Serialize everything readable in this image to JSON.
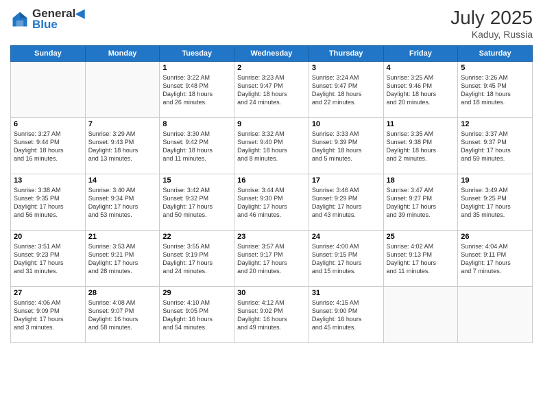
{
  "header": {
    "logo_line1": "General",
    "logo_line2": "Blue",
    "month_year": "July 2025",
    "location": "Kaduy, Russia"
  },
  "weekdays": [
    "Sunday",
    "Monday",
    "Tuesday",
    "Wednesday",
    "Thursday",
    "Friday",
    "Saturday"
  ],
  "weeks": [
    [
      {
        "day": "",
        "info": ""
      },
      {
        "day": "",
        "info": ""
      },
      {
        "day": "1",
        "info": "Sunrise: 3:22 AM\nSunset: 9:48 PM\nDaylight: 18 hours\nand 26 minutes."
      },
      {
        "day": "2",
        "info": "Sunrise: 3:23 AM\nSunset: 9:47 PM\nDaylight: 18 hours\nand 24 minutes."
      },
      {
        "day": "3",
        "info": "Sunrise: 3:24 AM\nSunset: 9:47 PM\nDaylight: 18 hours\nand 22 minutes."
      },
      {
        "day": "4",
        "info": "Sunrise: 3:25 AM\nSunset: 9:46 PM\nDaylight: 18 hours\nand 20 minutes."
      },
      {
        "day": "5",
        "info": "Sunrise: 3:26 AM\nSunset: 9:45 PM\nDaylight: 18 hours\nand 18 minutes."
      }
    ],
    [
      {
        "day": "6",
        "info": "Sunrise: 3:27 AM\nSunset: 9:44 PM\nDaylight: 18 hours\nand 16 minutes."
      },
      {
        "day": "7",
        "info": "Sunrise: 3:29 AM\nSunset: 9:43 PM\nDaylight: 18 hours\nand 13 minutes."
      },
      {
        "day": "8",
        "info": "Sunrise: 3:30 AM\nSunset: 9:42 PM\nDaylight: 18 hours\nand 11 minutes."
      },
      {
        "day": "9",
        "info": "Sunrise: 3:32 AM\nSunset: 9:40 PM\nDaylight: 18 hours\nand 8 minutes."
      },
      {
        "day": "10",
        "info": "Sunrise: 3:33 AM\nSunset: 9:39 PM\nDaylight: 18 hours\nand 5 minutes."
      },
      {
        "day": "11",
        "info": "Sunrise: 3:35 AM\nSunset: 9:38 PM\nDaylight: 18 hours\nand 2 minutes."
      },
      {
        "day": "12",
        "info": "Sunrise: 3:37 AM\nSunset: 9:37 PM\nDaylight: 17 hours\nand 59 minutes."
      }
    ],
    [
      {
        "day": "13",
        "info": "Sunrise: 3:38 AM\nSunset: 9:35 PM\nDaylight: 17 hours\nand 56 minutes."
      },
      {
        "day": "14",
        "info": "Sunrise: 3:40 AM\nSunset: 9:34 PM\nDaylight: 17 hours\nand 53 minutes."
      },
      {
        "day": "15",
        "info": "Sunrise: 3:42 AM\nSunset: 9:32 PM\nDaylight: 17 hours\nand 50 minutes."
      },
      {
        "day": "16",
        "info": "Sunrise: 3:44 AM\nSunset: 9:30 PM\nDaylight: 17 hours\nand 46 minutes."
      },
      {
        "day": "17",
        "info": "Sunrise: 3:46 AM\nSunset: 9:29 PM\nDaylight: 17 hours\nand 43 minutes."
      },
      {
        "day": "18",
        "info": "Sunrise: 3:47 AM\nSunset: 9:27 PM\nDaylight: 17 hours\nand 39 minutes."
      },
      {
        "day": "19",
        "info": "Sunrise: 3:49 AM\nSunset: 9:25 PM\nDaylight: 17 hours\nand 35 minutes."
      }
    ],
    [
      {
        "day": "20",
        "info": "Sunrise: 3:51 AM\nSunset: 9:23 PM\nDaylight: 17 hours\nand 31 minutes."
      },
      {
        "day": "21",
        "info": "Sunrise: 3:53 AM\nSunset: 9:21 PM\nDaylight: 17 hours\nand 28 minutes."
      },
      {
        "day": "22",
        "info": "Sunrise: 3:55 AM\nSunset: 9:19 PM\nDaylight: 17 hours\nand 24 minutes."
      },
      {
        "day": "23",
        "info": "Sunrise: 3:57 AM\nSunset: 9:17 PM\nDaylight: 17 hours\nand 20 minutes."
      },
      {
        "day": "24",
        "info": "Sunrise: 4:00 AM\nSunset: 9:15 PM\nDaylight: 17 hours\nand 15 minutes."
      },
      {
        "day": "25",
        "info": "Sunrise: 4:02 AM\nSunset: 9:13 PM\nDaylight: 17 hours\nand 11 minutes."
      },
      {
        "day": "26",
        "info": "Sunrise: 4:04 AM\nSunset: 9:11 PM\nDaylight: 17 hours\nand 7 minutes."
      }
    ],
    [
      {
        "day": "27",
        "info": "Sunrise: 4:06 AM\nSunset: 9:09 PM\nDaylight: 17 hours\nand 3 minutes."
      },
      {
        "day": "28",
        "info": "Sunrise: 4:08 AM\nSunset: 9:07 PM\nDaylight: 16 hours\nand 58 minutes."
      },
      {
        "day": "29",
        "info": "Sunrise: 4:10 AM\nSunset: 9:05 PM\nDaylight: 16 hours\nand 54 minutes."
      },
      {
        "day": "30",
        "info": "Sunrise: 4:12 AM\nSunset: 9:02 PM\nDaylight: 16 hours\nand 49 minutes."
      },
      {
        "day": "31",
        "info": "Sunrise: 4:15 AM\nSunset: 9:00 PM\nDaylight: 16 hours\nand 45 minutes."
      },
      {
        "day": "",
        "info": ""
      },
      {
        "day": "",
        "info": ""
      }
    ]
  ]
}
